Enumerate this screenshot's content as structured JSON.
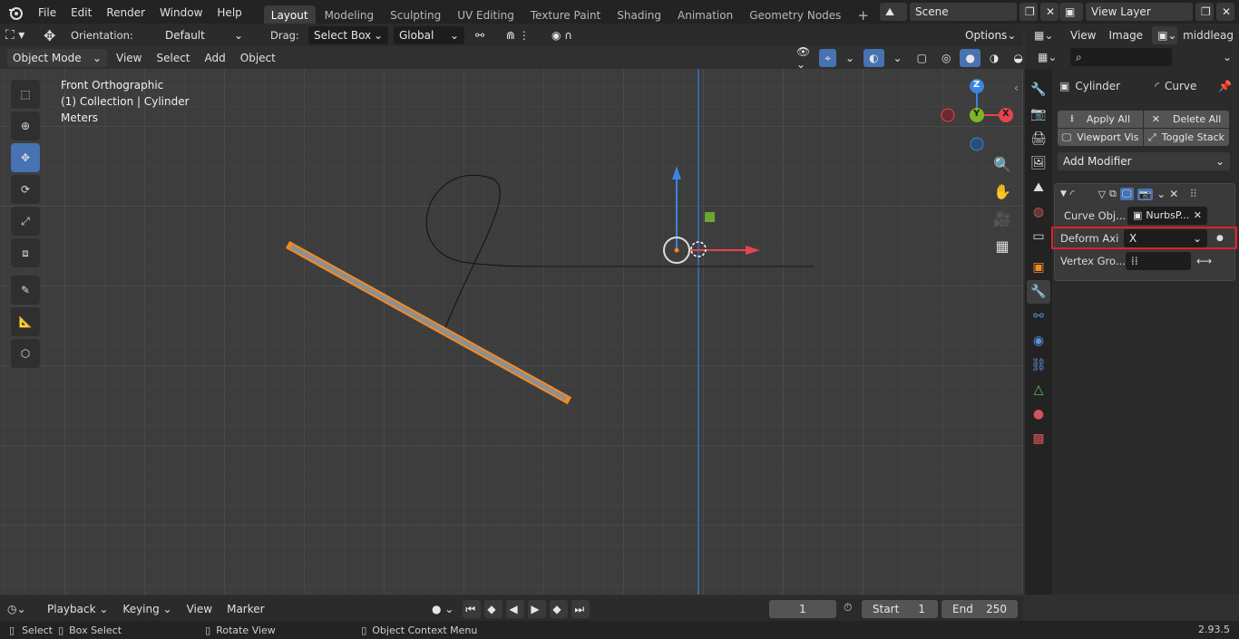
{
  "topbar": {
    "menus": [
      "File",
      "Edit",
      "Render",
      "Window",
      "Help"
    ],
    "workspaces": [
      "Layout",
      "Modeling",
      "Sculpting",
      "UV Editing",
      "Texture Paint",
      "Shading",
      "Animation",
      "Geometry Nodes"
    ],
    "active_workspace": "Layout",
    "scene": "Scene",
    "view_layer": "View Layer"
  },
  "tool_header": {
    "orientation_label": "Orientation:",
    "orientation_value": "Default",
    "drag_label": "Drag:",
    "drag_value": "Select Box",
    "transform_value": "Global",
    "options_label": "Options"
  },
  "viewport_header": {
    "mode": "Object Mode",
    "menus": [
      "View",
      "Select",
      "Add",
      "Object"
    ]
  },
  "viewport": {
    "view_name": "Front Orthographic",
    "collection": "(1) Collection | Cylinder",
    "units": "Meters",
    "gizmo_axes": {
      "z": "Z",
      "y": "Y",
      "x": "X"
    }
  },
  "image_editor": {
    "menus": [
      "View",
      "Image"
    ],
    "image_name": "middleage"
  },
  "properties": {
    "object_name": "Cylinder",
    "modifier_type": "Curve",
    "apply_all": "Apply All",
    "delete_all": "Delete All",
    "viewport_vis": "Viewport Vis",
    "toggle_stack": "Toggle Stack",
    "add_modifier": "Add Modifier",
    "curve_object_label": "Curve Obj...",
    "curve_object_value": "NurbsP...",
    "deform_axis_label": "Deform Axi",
    "deform_axis_value": "X",
    "vertex_group_label": "Vertex Gro..."
  },
  "timeline": {
    "menus": [
      "Playback",
      "Keying",
      "View",
      "Marker"
    ],
    "current_frame": "1",
    "start_label": "Start",
    "start_value": "1",
    "end_label": "End",
    "end_value": "250"
  },
  "statusbar": {
    "select": "Select",
    "box_select": "Box Select",
    "rotate_view": "Rotate View",
    "context_menu": "Object Context Menu",
    "version": "2.93.5"
  },
  "colors": {
    "accent": "#4772b3",
    "highlight": "#e0202a",
    "selection": "#f08a24"
  }
}
